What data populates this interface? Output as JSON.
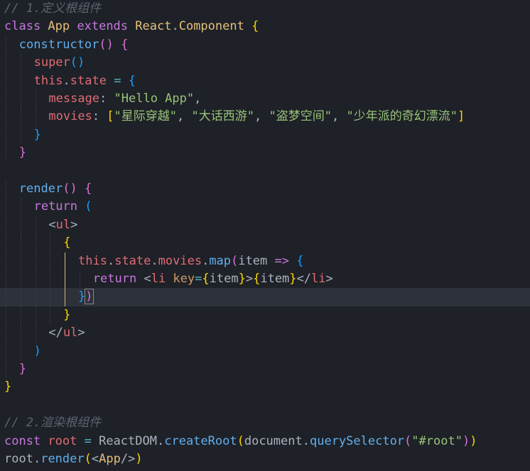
{
  "editor": {
    "lines": [
      {
        "indent": 0,
        "tokens": [
          [
            "// 1.定义根组件",
            "cm"
          ]
        ]
      },
      {
        "indent": 0,
        "tokens": [
          [
            "class ",
            "kw"
          ],
          [
            "App ",
            "cls"
          ],
          [
            "extends ",
            "kw"
          ],
          [
            "React",
            "cls"
          ],
          [
            ".",
            "pun"
          ],
          [
            "Component ",
            "cls"
          ],
          [
            "{",
            "b1"
          ]
        ]
      },
      {
        "indent": 1,
        "tokens": [
          [
            "constructor",
            "fn"
          ],
          [
            "() ",
            "b2"
          ],
          [
            "{",
            "b2"
          ]
        ]
      },
      {
        "indent": 2,
        "tokens": [
          [
            "super",
            "var"
          ],
          [
            "()",
            "b3"
          ]
        ]
      },
      {
        "indent": 2,
        "tokens": [
          [
            "this",
            "var"
          ],
          [
            ".",
            "pun"
          ],
          [
            "state",
            "var"
          ],
          [
            " = ",
            "op"
          ],
          [
            "{",
            "b3"
          ]
        ]
      },
      {
        "indent": 3,
        "tokens": [
          [
            "message",
            "var"
          ],
          [
            ": ",
            "pun"
          ],
          [
            "\"Hello App\"",
            "str"
          ],
          [
            ",",
            "pun"
          ]
        ]
      },
      {
        "indent": 3,
        "tokens": [
          [
            "movies",
            "var"
          ],
          [
            ": ",
            "pun"
          ],
          [
            "[",
            "b1"
          ],
          [
            "\"星际穿越\"",
            "str"
          ],
          [
            ", ",
            "pun"
          ],
          [
            "\"大话西游\"",
            "str"
          ],
          [
            ", ",
            "pun"
          ],
          [
            "\"盗梦空间\"",
            "str"
          ],
          [
            ", ",
            "pun"
          ],
          [
            "\"少年派的奇幻漂流\"",
            "str"
          ],
          [
            "]",
            "b1"
          ]
        ]
      },
      {
        "indent": 2,
        "tokens": [
          [
            "}",
            "b3"
          ]
        ]
      },
      {
        "indent": 1,
        "tokens": [
          [
            "}",
            "b2"
          ]
        ]
      },
      {
        "indent": 0,
        "tokens": []
      },
      {
        "indent": 1,
        "tokens": [
          [
            "render",
            "fn"
          ],
          [
            "() ",
            "b2"
          ],
          [
            "{",
            "b2"
          ]
        ]
      },
      {
        "indent": 2,
        "tokens": [
          [
            "return ",
            "kw"
          ],
          [
            "(",
            "b3"
          ]
        ]
      },
      {
        "indent": 3,
        "tokens": [
          [
            "<",
            "pun"
          ],
          [
            "ul",
            "tag"
          ],
          [
            ">",
            "pun"
          ]
        ]
      },
      {
        "indent": 4,
        "tokens": [
          [
            "{",
            "b1"
          ]
        ]
      },
      {
        "indent": 5,
        "tokens": [
          [
            "this",
            "var"
          ],
          [
            ".",
            "pun"
          ],
          [
            "state",
            "var"
          ],
          [
            ".",
            "pun"
          ],
          [
            "movies",
            "var"
          ],
          [
            ".",
            "pun"
          ],
          [
            "map",
            "fn"
          ],
          [
            "(",
            "b2"
          ],
          [
            "item ",
            "txt"
          ],
          [
            "=> ",
            "kw"
          ],
          [
            "{",
            "b3"
          ]
        ]
      },
      {
        "indent": 6,
        "tokens": [
          [
            "return ",
            "kw"
          ],
          [
            "<",
            "pun"
          ],
          [
            "li ",
            "tag"
          ],
          [
            "key",
            "attr"
          ],
          [
            "=",
            "op"
          ],
          [
            "{",
            "b1"
          ],
          [
            "item",
            "txt"
          ],
          [
            "}",
            "b1"
          ],
          [
            ">",
            "pun"
          ],
          [
            "{",
            "b1"
          ],
          [
            "item",
            "txt"
          ],
          [
            "}",
            "b1"
          ],
          [
            "</",
            "pun"
          ],
          [
            "li",
            "tag"
          ],
          [
            ">",
            "pun"
          ]
        ]
      },
      {
        "indent": 5,
        "tokens": [
          [
            "}",
            "b3"
          ],
          [
            ")",
            "b2"
          ]
        ],
        "current": true
      },
      {
        "indent": 4,
        "tokens": [
          [
            "}",
            "b1"
          ]
        ]
      },
      {
        "indent": 3,
        "tokens": [
          [
            "</",
            "pun"
          ],
          [
            "ul",
            "tag"
          ],
          [
            ">",
            "pun"
          ]
        ]
      },
      {
        "indent": 2,
        "tokens": [
          [
            ")",
            "b3"
          ]
        ]
      },
      {
        "indent": 1,
        "tokens": [
          [
            "}",
            "b2"
          ]
        ]
      },
      {
        "indent": 0,
        "tokens": [
          [
            "}",
            "b1"
          ]
        ]
      },
      {
        "indent": 0,
        "tokens": []
      },
      {
        "indent": 0,
        "tokens": [
          [
            "// 2.渲染根组件",
            "cm"
          ]
        ]
      },
      {
        "indent": 0,
        "tokens": [
          [
            "const ",
            "kw"
          ],
          [
            "root ",
            "var"
          ],
          [
            "= ",
            "op"
          ],
          [
            "ReactDOM",
            "txt"
          ],
          [
            ".",
            "pun"
          ],
          [
            "createRoot",
            "fn"
          ],
          [
            "(",
            "b1"
          ],
          [
            "document",
            "txt"
          ],
          [
            ".",
            "pun"
          ],
          [
            "querySelector",
            "fn"
          ],
          [
            "(",
            "b2"
          ],
          [
            "\"#root\"",
            "str"
          ],
          [
            ")",
            "b2"
          ],
          [
            ")",
            "b1"
          ]
        ]
      },
      {
        "indent": 0,
        "tokens": [
          [
            "root",
            "txt"
          ],
          [
            ".",
            "pun"
          ],
          [
            "render",
            "fn"
          ],
          [
            "(",
            "b1"
          ],
          [
            "<",
            "pun"
          ],
          [
            "App",
            "cls"
          ],
          [
            "/>",
            "pun"
          ],
          [
            ")",
            "b1"
          ]
        ]
      }
    ]
  }
}
